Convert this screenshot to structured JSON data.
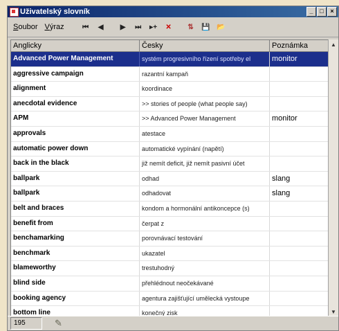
{
  "window": {
    "title": "Uživatelský slovník",
    "controls": [
      "_",
      "□",
      "×"
    ]
  },
  "toolbar": {
    "menu": [
      "Soubor",
      "Výraz"
    ],
    "buttons": [
      {
        "name": "first-record-icon",
        "glyph": "⏮"
      },
      {
        "name": "prev-record-icon",
        "glyph": "◀"
      },
      {
        "name": "next-record-icon",
        "glyph": "▶"
      },
      {
        "name": "last-record-icon",
        "glyph": "⏭"
      },
      {
        "name": "insert-record-icon",
        "glyph": "▸+"
      },
      {
        "name": "delete-record-icon",
        "glyph": "✕"
      },
      {
        "name": "sort-icon",
        "glyph": "⇅"
      },
      {
        "name": "save-icon",
        "glyph": "💾"
      },
      {
        "name": "open-folder-icon",
        "glyph": "📂"
      }
    ]
  },
  "table": {
    "columns": [
      "Anglicky",
      "Česky",
      "Poznámka"
    ],
    "rows": [
      {
        "en": "Advanced Power Management",
        "cz": "systém progresivního řízení spotřeby el",
        "note": "monitor",
        "selected": true
      },
      {
        "en": "aggressive campaign",
        "cz": "razantní kampaň",
        "note": ""
      },
      {
        "en": "alignment",
        "cz": "koordinace",
        "note": ""
      },
      {
        "en": "anecdotal evidence",
        "cz": ">> stories of people (what people say)",
        "note": ""
      },
      {
        "en": "APM",
        "cz": ">> Advanced Power Management",
        "note": "monitor"
      },
      {
        "en": "approvals",
        "cz": "atestace",
        "note": ""
      },
      {
        "en": "automatic power down",
        "cz": "automatické vypínání (napětí)",
        "note": ""
      },
      {
        "en": "back in the black",
        "cz": "již nemít deficit, již nemít pasivní účet",
        "note": ""
      },
      {
        "en": "ballpark",
        "cz": "odhad",
        "note": "slang"
      },
      {
        "en": "ballpark",
        "cz": "odhadovat",
        "note": "slang"
      },
      {
        "en": "belt and braces",
        "cz": "kondom a hormonální antikoncepce (s)",
        "note": ""
      },
      {
        "en": "benefit from",
        "cz": "čerpat z",
        "note": ""
      },
      {
        "en": "benchamarking",
        "cz": "porovnávací testování",
        "note": ""
      },
      {
        "en": "benchmark",
        "cz": "ukazatel",
        "note": ""
      },
      {
        "en": "blameworthy",
        "cz": "trestuhodný",
        "note": ""
      },
      {
        "en": "blind side",
        "cz": "přehlédnout neočekávané",
        "note": ""
      },
      {
        "en": "booking agency",
        "cz": "agentura zajišťující umělecká vystoupe",
        "note": ""
      },
      {
        "en": "bottom line",
        "cz": "konečný zisk",
        "note": ""
      }
    ]
  },
  "status": {
    "count": "195"
  }
}
